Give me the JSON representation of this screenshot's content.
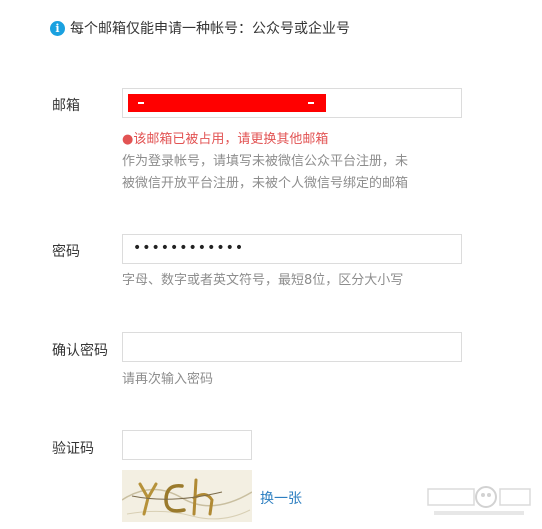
{
  "notice": {
    "text": "每个邮箱仅能申请一种帐号：公众号或企业号"
  },
  "email": {
    "label": "邮箱",
    "error": "●该邮箱已被占用，请更换其他邮箱",
    "hint_line1": "作为登录帐号，请填写未被微信公众平台注册，未",
    "hint_line2": "被微信开放平台注册，未被个人微信号绑定的邮箱"
  },
  "password": {
    "label": "密码",
    "value": "••••••••••••",
    "hint": "字母、数字或者英文符号，最短8位，区分大小写"
  },
  "confirm_password": {
    "label": "确认密码",
    "hint": "请再次输入密码"
  },
  "captcha": {
    "label": "验证码",
    "refresh_label": "换一张"
  },
  "colors": {
    "accent": "#1aa1e0",
    "error": "#e25353",
    "link": "#2d7fc1",
    "redaction": "#ff0000"
  }
}
